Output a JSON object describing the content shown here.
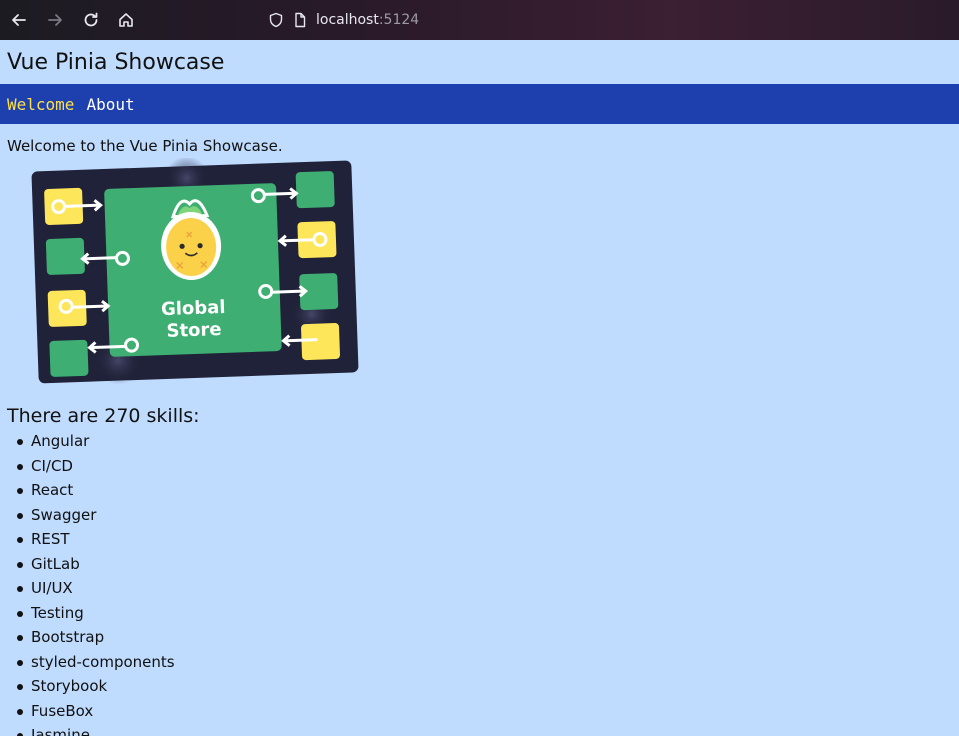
{
  "browser": {
    "url_host": "localhost",
    "url_port": ":5124"
  },
  "app": {
    "title": "Vue Pinia Showcase"
  },
  "nav": {
    "items": [
      {
        "label": "Welcome",
        "active": true
      },
      {
        "label": "About",
        "active": false
      }
    ]
  },
  "main": {
    "welcome_text": "Welcome to the Vue Pinia Showcase.",
    "image_caption_line1": "Global",
    "image_caption_line2": "Store",
    "skills_heading": "There are 270 skills:",
    "skills": [
      "Angular",
      "CI/CD",
      "React",
      "Swagger",
      "REST",
      "GitLab",
      "UI/UX",
      "Testing",
      "Bootstrap",
      "styled-components",
      "Storybook",
      "FuseBox",
      "Jasmine"
    ]
  },
  "colors": {
    "page_bg": "#bfdbfe",
    "nav_bg": "#1e40af",
    "nav_active": "#fde047",
    "nav_text": "#ffffff"
  }
}
